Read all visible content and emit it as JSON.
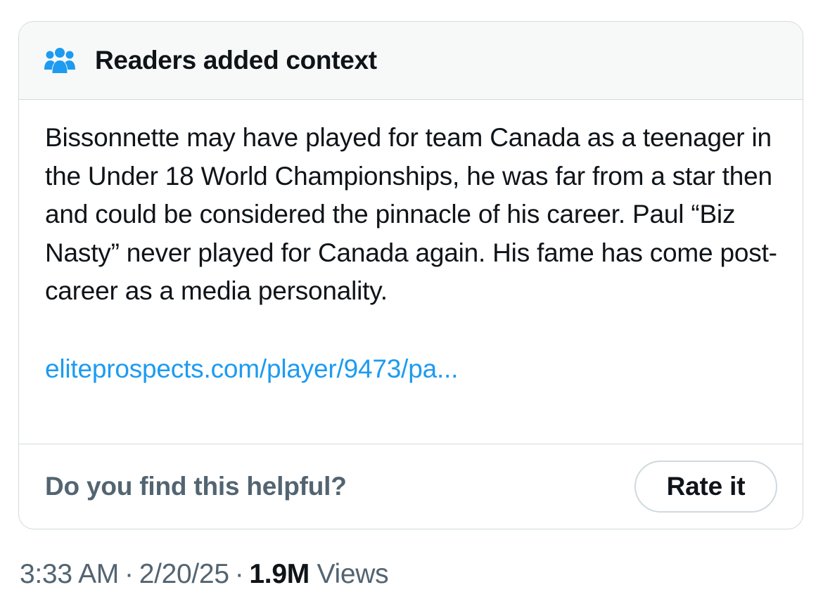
{
  "note": {
    "header_title": "Readers added context",
    "header_icon": "people-icon",
    "body_text": "Bissonnette may have played for team Canada as a teenager in the Under 18 World Championships, he was far from a star then and could be considered the pinnacle of his career. Paul “Biz Nasty” never played for Canada again. His fame has come post-career as a media personality.",
    "link_text": "eliteprospects.com/player/9473/pa...",
    "helpful_question": "Do you find this helpful?",
    "rate_button_label": "Rate it"
  },
  "meta": {
    "time": "3:33 AM",
    "separator": "·",
    "date": "2/20/25",
    "views_count": "1.9M",
    "views_label": "Views"
  },
  "colors": {
    "accent": "#1d9bf0",
    "text_primary": "#0f1419",
    "text_secondary": "#536471",
    "border": "#d3dade",
    "header_bg": "#f7f9f9"
  }
}
